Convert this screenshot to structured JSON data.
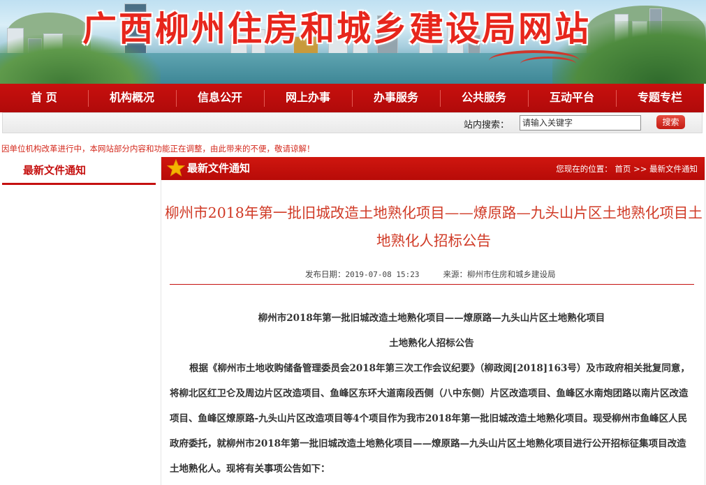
{
  "site": {
    "banner_title": "广西柳州住房和城乡建设局网站"
  },
  "nav": {
    "items": [
      {
        "label": "首 页"
      },
      {
        "label": "机构概况"
      },
      {
        "label": "信息公开"
      },
      {
        "label": "网上办事"
      },
      {
        "label": "办事服务"
      },
      {
        "label": "公共服务"
      },
      {
        "label": "互动平台"
      },
      {
        "label": "专题专栏"
      }
    ]
  },
  "search": {
    "label": "站内搜索：",
    "placeholder": "请输入关键字",
    "button": "搜索"
  },
  "notice": "因单位机构改革进行中，本网站部分内容和功能正在调整，由此带来的不便，敬请谅解！",
  "sidebar": {
    "title": "最新文件通知"
  },
  "panel": {
    "title": "最新文件通知",
    "breadcrumb": {
      "prefix": "您现在的位置：",
      "home": "首页",
      "sep": ">>",
      "current": "最新文件通知"
    }
  },
  "article": {
    "title": "柳州市2018年第一批旧城改造土地熟化项目——燎原路—九头山片区土地熟化项目土地熟化人招标公告",
    "date_label": "发布日期：",
    "date": "2019-07-08 15:23",
    "source_label": "来源：",
    "source": "柳州市住房和城乡建设局",
    "heading_line1": "柳州市2018年第一批旧城改造土地熟化项目——燎原路—九头山片区土地熟化项目",
    "heading_line2": "土地熟化人招标公告",
    "paragraph": "根据《柳州市土地收购储备管理委员会2018年第三次工作会议纪要》（柳政阅[2018]163号）及市政府相关批复同意，将柳北区红卫仑及周边片区改造项目、鱼峰区东环大道南段西侧（八中东侧）片区改造项目、鱼峰区水南炮团路以南片区改造项目、鱼峰区燎原路-九头山片区改造项目等4个项目作为我市2018年第一批旧城改造土地熟化项目。现受柳州市鱼峰区人民政府委托，就柳州市2018年第一批旧城改造土地熟化项目——燎原路—九头山片区土地熟化项目进行公开招标征集项目改造土地熟化人。现将有关事项公告如下："
  }
}
